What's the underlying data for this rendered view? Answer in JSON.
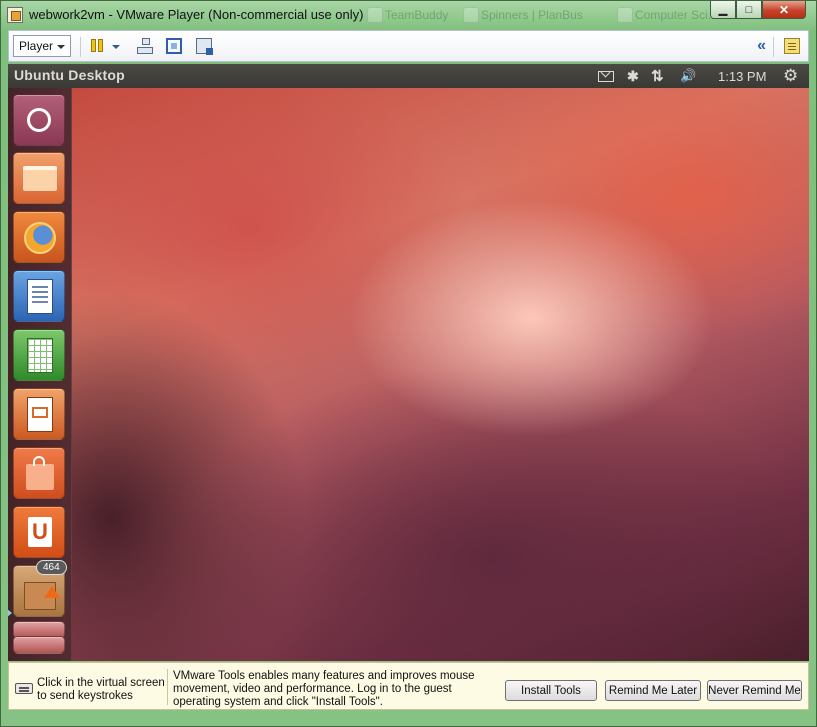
{
  "window": {
    "title": "webwork2vm - VMware Player (Non-commercial use only)",
    "minimize_glyph": "▁",
    "maximize_glyph": "□",
    "close_glyph": "✕",
    "ghost_tabs": [
      "TeamBuddy",
      "Spinners | PlanBus",
      "Computer Sci..."
    ]
  },
  "toolbar": {
    "player_menu_label": "Player",
    "collapse_glyph": "«"
  },
  "guest": {
    "topbar_title": "Ubuntu Desktop",
    "clock": "1:13 PM",
    "bluetooth_glyph": "✱",
    "network_glyph": "⇅",
    "volume_glyph": "🔊",
    "gear_glyph": "⚙",
    "launcher": {
      "update_badge": "464",
      "ubuntu_one_letter": "U"
    }
  },
  "notify": {
    "click_text": "Click in the virtual screen to send keystrokes",
    "tools_text": "VMware Tools enables many features and improves mouse movement, video and performance. Log in to the guest operating system and click \"Install Tools\".",
    "install_label": "Install Tools",
    "remind_label": "Remind Me Later",
    "never_label": "Never Remind Me"
  },
  "colors": {
    "frame": "#86c284",
    "ubuntu_topbar": "#3c3b37",
    "notify_bg": "#fdfbe3",
    "close_red": "#c7422a"
  }
}
